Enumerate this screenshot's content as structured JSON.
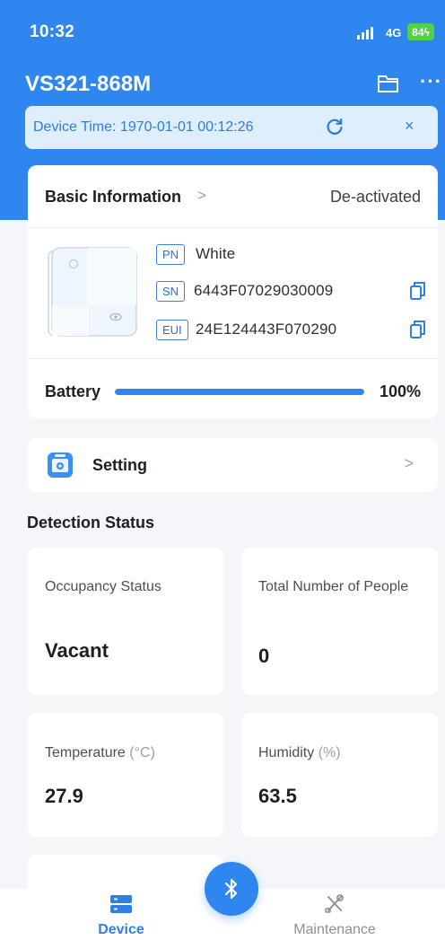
{
  "status_bar": {
    "time": "10:32",
    "network": "4G",
    "battery": "84"
  },
  "header": {
    "title": "VS321-868M",
    "folder_icon": "folder-icon",
    "more_label": "···"
  },
  "time_banner": {
    "text": "Device Time: 1970-01-01 00:12:26",
    "refresh_icon": "refresh-icon",
    "close_label": "×"
  },
  "basic_info": {
    "label": "Basic Information",
    "chevron": ">",
    "state": "De-activated",
    "rows": [
      {
        "tag": "PN",
        "value": "White"
      },
      {
        "tag": "SN",
        "value": "6443F07029030009"
      },
      {
        "tag": "EUI",
        "value": "24E124443F070290"
      }
    ],
    "battery_label": "Battery",
    "battery_percent_text": "100%",
    "battery_level": 1.0
  },
  "setting": {
    "label": "Setting",
    "chevron": ">"
  },
  "detection": {
    "title": "Detection Status",
    "occupancy": {
      "label": "Occupancy Status",
      "value": "Vacant"
    },
    "people": {
      "label": "Total Number of People",
      "value": "0"
    },
    "temperature": {
      "label": "Temperature",
      "unit": "(°C)",
      "value": "27.9"
    },
    "humidity": {
      "label": "Humidity",
      "unit": "(%)",
      "value": "63.5"
    }
  },
  "tabs": {
    "device": "Device",
    "maintenance": "Maintenance"
  },
  "colors": {
    "accent": "#2f86ee",
    "banner_bg": "#dfeefc",
    "battery_green": "#51d14a"
  }
}
